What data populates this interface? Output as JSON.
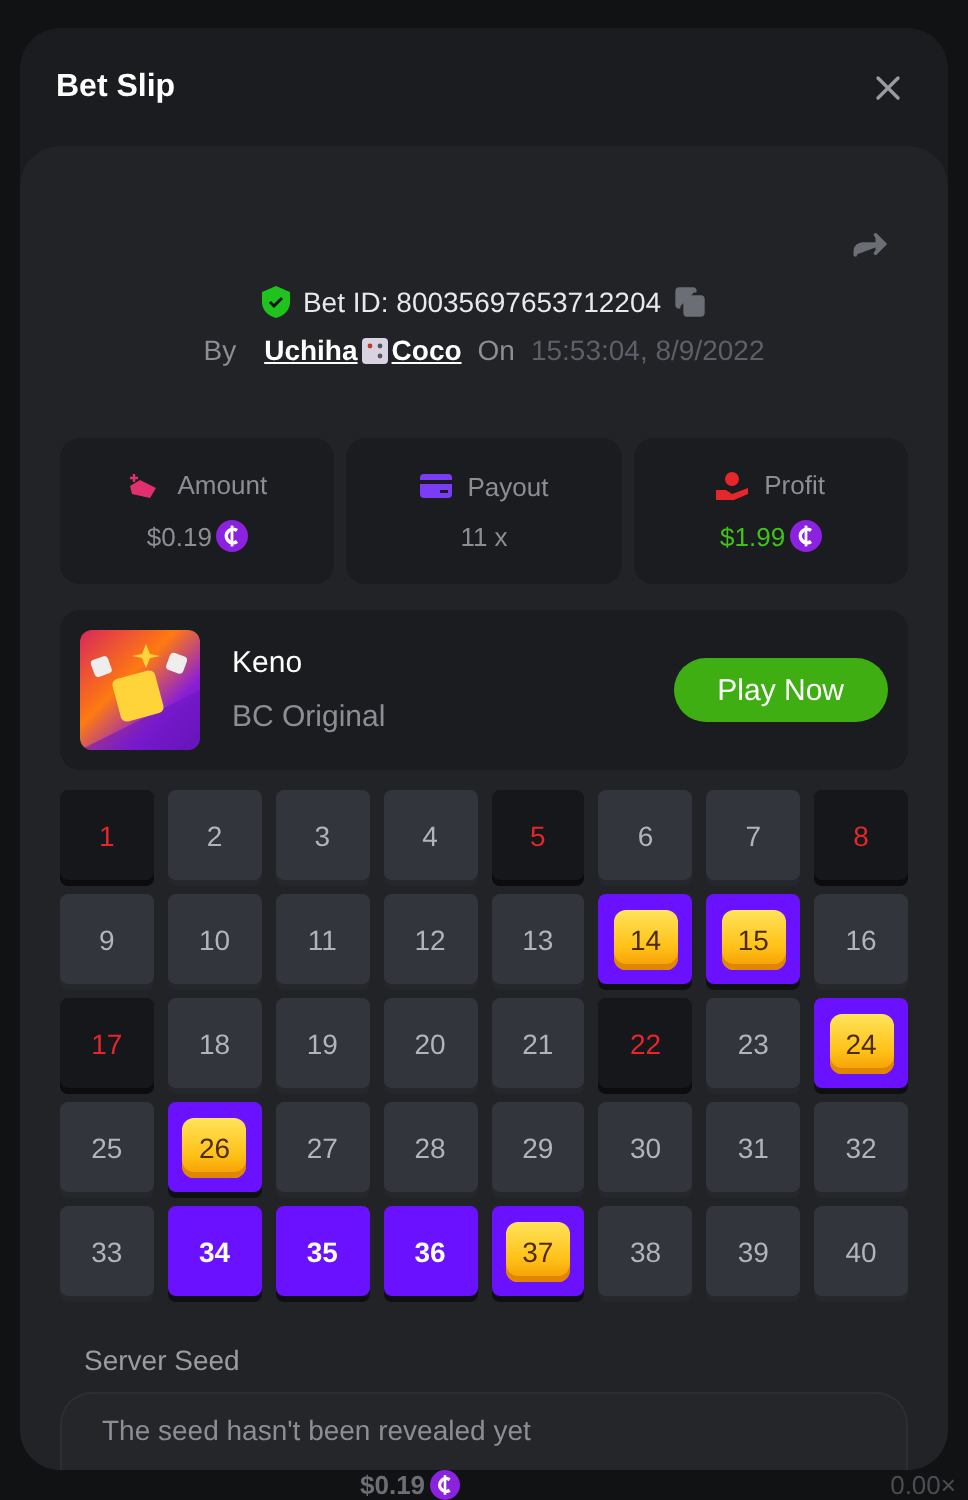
{
  "dialog": {
    "title": "Bet Slip"
  },
  "bet": {
    "id_label": "Bet ID: 80035697653712204",
    "by_label": "By",
    "user_first": "Uchiha",
    "user_last": "Coco",
    "on_label": "On",
    "time": "15:53:04, 8/9/2022"
  },
  "stats": [
    {
      "kind": "amount",
      "label": "Amount",
      "value": "$0.19",
      "coin": true
    },
    {
      "kind": "payout",
      "label": "Payout",
      "value": "11 x",
      "coin": false
    },
    {
      "kind": "profit",
      "label": "Profit",
      "value": "$1.99",
      "coin": true
    }
  ],
  "game": {
    "name": "Keno",
    "provider": "BC Original",
    "button": "Play Now"
  },
  "cells": [
    {
      "n": "1",
      "selected": false,
      "drawn": true
    },
    {
      "n": "2",
      "selected": false,
      "drawn": false
    },
    {
      "n": "3",
      "selected": false,
      "drawn": false
    },
    {
      "n": "4",
      "selected": false,
      "drawn": false
    },
    {
      "n": "5",
      "selected": false,
      "drawn": true
    },
    {
      "n": "6",
      "selected": false,
      "drawn": false
    },
    {
      "n": "7",
      "selected": false,
      "drawn": false
    },
    {
      "n": "8",
      "selected": false,
      "drawn": true
    },
    {
      "n": "9",
      "selected": false,
      "drawn": false
    },
    {
      "n": "10",
      "selected": false,
      "drawn": false
    },
    {
      "n": "11",
      "selected": false,
      "drawn": false
    },
    {
      "n": "12",
      "selected": false,
      "drawn": false
    },
    {
      "n": "13",
      "selected": false,
      "drawn": false
    },
    {
      "n": "14",
      "selected": true,
      "drawn": true
    },
    {
      "n": "15",
      "selected": true,
      "drawn": true
    },
    {
      "n": "16",
      "selected": false,
      "drawn": false
    },
    {
      "n": "17",
      "selected": false,
      "drawn": true
    },
    {
      "n": "18",
      "selected": false,
      "drawn": false
    },
    {
      "n": "19",
      "selected": false,
      "drawn": false
    },
    {
      "n": "20",
      "selected": false,
      "drawn": false
    },
    {
      "n": "21",
      "selected": false,
      "drawn": false
    },
    {
      "n": "22",
      "selected": false,
      "drawn": true
    },
    {
      "n": "23",
      "selected": false,
      "drawn": false
    },
    {
      "n": "24",
      "selected": true,
      "drawn": true
    },
    {
      "n": "25",
      "selected": false,
      "drawn": false
    },
    {
      "n": "26",
      "selected": true,
      "drawn": true
    },
    {
      "n": "27",
      "selected": false,
      "drawn": false
    },
    {
      "n": "28",
      "selected": false,
      "drawn": false
    },
    {
      "n": "29",
      "selected": false,
      "drawn": false
    },
    {
      "n": "30",
      "selected": false,
      "drawn": false
    },
    {
      "n": "31",
      "selected": false,
      "drawn": false
    },
    {
      "n": "32",
      "selected": false,
      "drawn": false
    },
    {
      "n": "33",
      "selected": false,
      "drawn": false
    },
    {
      "n": "34",
      "selected": true,
      "drawn": false
    },
    {
      "n": "35",
      "selected": true,
      "drawn": false
    },
    {
      "n": "36",
      "selected": true,
      "drawn": false
    },
    {
      "n": "37",
      "selected": true,
      "drawn": true
    },
    {
      "n": "38",
      "selected": false,
      "drawn": false
    },
    {
      "n": "39",
      "selected": false,
      "drawn": false
    },
    {
      "n": "40",
      "selected": false,
      "drawn": false
    }
  ],
  "seed": {
    "label": "Server Seed",
    "text": "The seed hasn't been revealed yet"
  },
  "footer": {
    "amount": "$0.19",
    "multiplier": "0.00×"
  }
}
